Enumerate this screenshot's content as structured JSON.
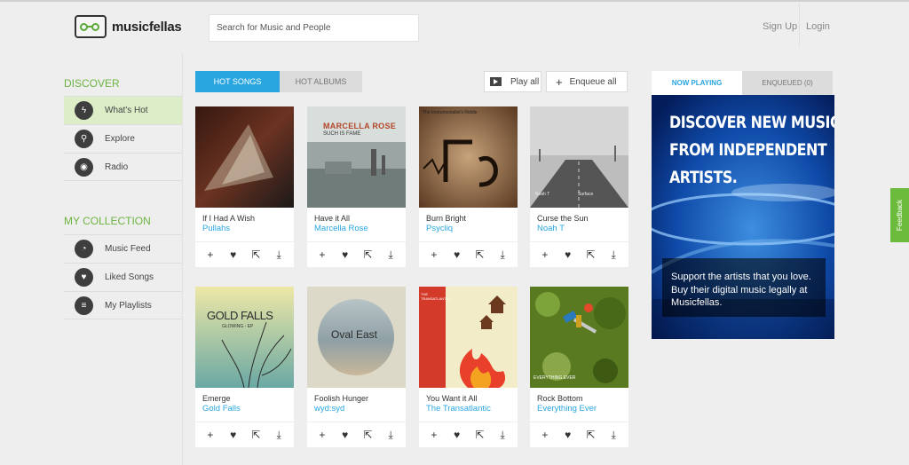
{
  "header": {
    "logo_text": "musicfellas",
    "search_placeholder": "Search for Music and People",
    "signup": "Sign Up",
    "login": "Login"
  },
  "sidebar": {
    "discover_heading": "DISCOVER",
    "discover": [
      {
        "label": "What's Hot",
        "icon": "lightning-icon",
        "active": true
      },
      {
        "label": "Explore",
        "icon": "search-icon"
      },
      {
        "label": "Radio",
        "icon": "radio-icon"
      }
    ],
    "collection_heading": "MY COLLECTION",
    "collection": [
      {
        "label": "Music Feed",
        "icon": "rss-icon"
      },
      {
        "label": "Liked Songs",
        "icon": "heart-icon"
      },
      {
        "label": "My Playlists",
        "icon": "playlist-icon"
      }
    ]
  },
  "tabs": {
    "hot_songs": "HOT SONGS",
    "hot_albums": "HOT ALBUMS"
  },
  "actions": {
    "play_all": "Play all",
    "enqueue_all": "Enqueue all"
  },
  "songs": [
    {
      "title": "If I Had A Wish",
      "artist": "Pullahs"
    },
    {
      "title": "Have it All",
      "artist": "Marcella Rose",
      "cover_text": "MARCELLA ROSE",
      "cover_sub": "SUCH IS FAME"
    },
    {
      "title": "Burn Bright",
      "artist": "Psycliq",
      "cover_text": "The Instrumentalist's Riddle"
    },
    {
      "title": "Curse the Sun",
      "artist": "Noah T",
      "cover_text": "Noah T",
      "cover_sub": "Surface"
    },
    {
      "title": "Emerge",
      "artist": "Gold Falls",
      "cover_text": "GOLD FALLS",
      "cover_sub": "GLOWING - EP"
    },
    {
      "title": "Foolish Hunger",
      "artist": "wyd:syd",
      "cover_text": "Oval East"
    },
    {
      "title": "You Want it All",
      "artist": "The Transatlantic",
      "cover_text": "THE TRANSATLANTIC"
    },
    {
      "title": "Rock Bottom",
      "artist": "Everything Ever",
      "cover_text": "EVERYTHING EVER"
    }
  ],
  "now_playing": {
    "tab_now": "NOW PLAYING",
    "tab_enqueued": "ENQUEUED (0)",
    "headline_1": "DISCOVER NEW MUSIC",
    "headline_2": "FROM INDEPENDENT",
    "headline_3": "ARTISTS.",
    "body": "Support the artists that you love. Buy their digital music legally at Musicfellas."
  },
  "feedback": "Feedback",
  "colors": {
    "accent_blue": "#29a6e0",
    "brand_green": "#6cb43f"
  }
}
